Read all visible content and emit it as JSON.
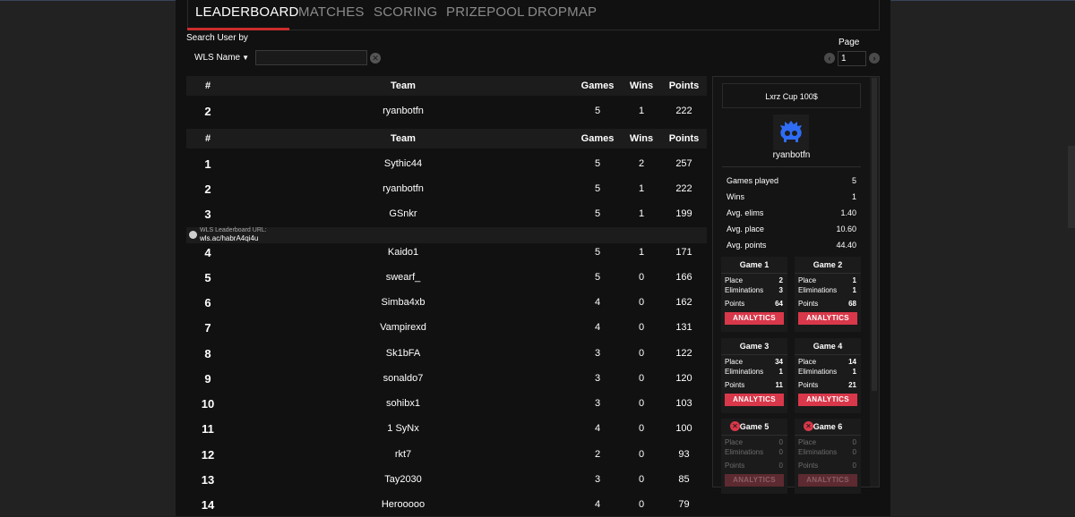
{
  "tabs": [
    {
      "label": "LEADERBOARD",
      "active": true
    },
    {
      "label": "MATCHES",
      "active": false
    },
    {
      "label": "SCORING",
      "active": false
    },
    {
      "label": "PRIZEPOOL",
      "active": false
    },
    {
      "label": "DROPMAP",
      "active": false
    }
  ],
  "search": {
    "label": "Search User by",
    "filter_value": "WLS Name",
    "query": ""
  },
  "pager": {
    "label": "Page",
    "current": "1"
  },
  "table": {
    "headers": {
      "rank": "#",
      "team": "Team",
      "games": "Games",
      "wins": "Wins",
      "points": "Points"
    },
    "highlight_row": {
      "rank": "2",
      "team": "ryanbotfn",
      "games": "5",
      "wins": "1",
      "points": "222"
    },
    "rows": [
      {
        "rank": "1",
        "team": "Sythic44",
        "games": "5",
        "wins": "2",
        "points": "257"
      },
      {
        "rank": "2",
        "team": "ryanbotfn",
        "games": "5",
        "wins": "1",
        "points": "222"
      },
      {
        "rank": "3",
        "team": "GSnkr",
        "games": "5",
        "wins": "1",
        "points": "199"
      },
      {
        "rank": "4",
        "team": "Kaido1",
        "games": "5",
        "wins": "1",
        "points": "171"
      },
      {
        "rank": "5",
        "team": "swearf_",
        "games": "5",
        "wins": "0",
        "points": "166"
      },
      {
        "rank": "6",
        "team": "Simba4xb",
        "games": "4",
        "wins": "0",
        "points": "162"
      },
      {
        "rank": "7",
        "team": "Vampirexd",
        "games": "4",
        "wins": "0",
        "points": "131"
      },
      {
        "rank": "8",
        "team": "Sk1bFA",
        "games": "3",
        "wins": "0",
        "points": "122"
      },
      {
        "rank": "9",
        "team": "sonaldo7",
        "games": "3",
        "wins": "0",
        "points": "120"
      },
      {
        "rank": "10",
        "team": "sohibx1",
        "games": "3",
        "wins": "0",
        "points": "103"
      },
      {
        "rank": "11",
        "team": "1 SyNx",
        "games": "4",
        "wins": "0",
        "points": "100"
      },
      {
        "rank": "12",
        "team": "rkt7",
        "games": "2",
        "wins": "0",
        "points": "93"
      },
      {
        "rank": "13",
        "team": "Tay2030",
        "games": "3",
        "wins": "0",
        "points": "85"
      },
      {
        "rank": "14",
        "team": "Herooooo",
        "games": "4",
        "wins": "0",
        "points": "79"
      }
    ],
    "banner": {
      "label": "WLS Leaderboard URL:",
      "url": "wls.ac/habrA4qi4u"
    }
  },
  "panel": {
    "cup_title": "Lxrz Cup 100$",
    "player_name": "ryanbotfn",
    "avatar_icon": "skull-icon",
    "accent": "#2f6cf5",
    "stats": [
      {
        "label": "Games played",
        "value": "5"
      },
      {
        "label": "Wins",
        "value": "1"
      },
      {
        "label": "Avg. elims",
        "value": "1.40"
      },
      {
        "label": "Avg. place",
        "value": "10.60"
      },
      {
        "label": "Avg. points",
        "value": "44.40"
      }
    ],
    "games": [
      {
        "title": "Game 1",
        "played": true,
        "place": "2",
        "elims": "3",
        "points": "64"
      },
      {
        "title": "Game 2",
        "played": true,
        "place": "1",
        "elims": "1",
        "points": "68"
      },
      {
        "title": "Game 3",
        "played": true,
        "place": "34",
        "elims": "1",
        "points": "11"
      },
      {
        "title": "Game 4",
        "played": true,
        "place": "14",
        "elims": "1",
        "points": "21"
      },
      {
        "title": "Game 5",
        "played": false,
        "place": "0",
        "elims": "0",
        "points": "0"
      },
      {
        "title": "Game 6",
        "played": false,
        "place": "0",
        "elims": "0",
        "points": "0"
      }
    ],
    "labels": {
      "place": "Place",
      "elims": "Eliminations",
      "points": "Points",
      "analytics": "ANALYTICS"
    }
  },
  "colors": {
    "accent_red": "#cc2c2c",
    "button_red": "#d8384a",
    "background": "#111111"
  }
}
